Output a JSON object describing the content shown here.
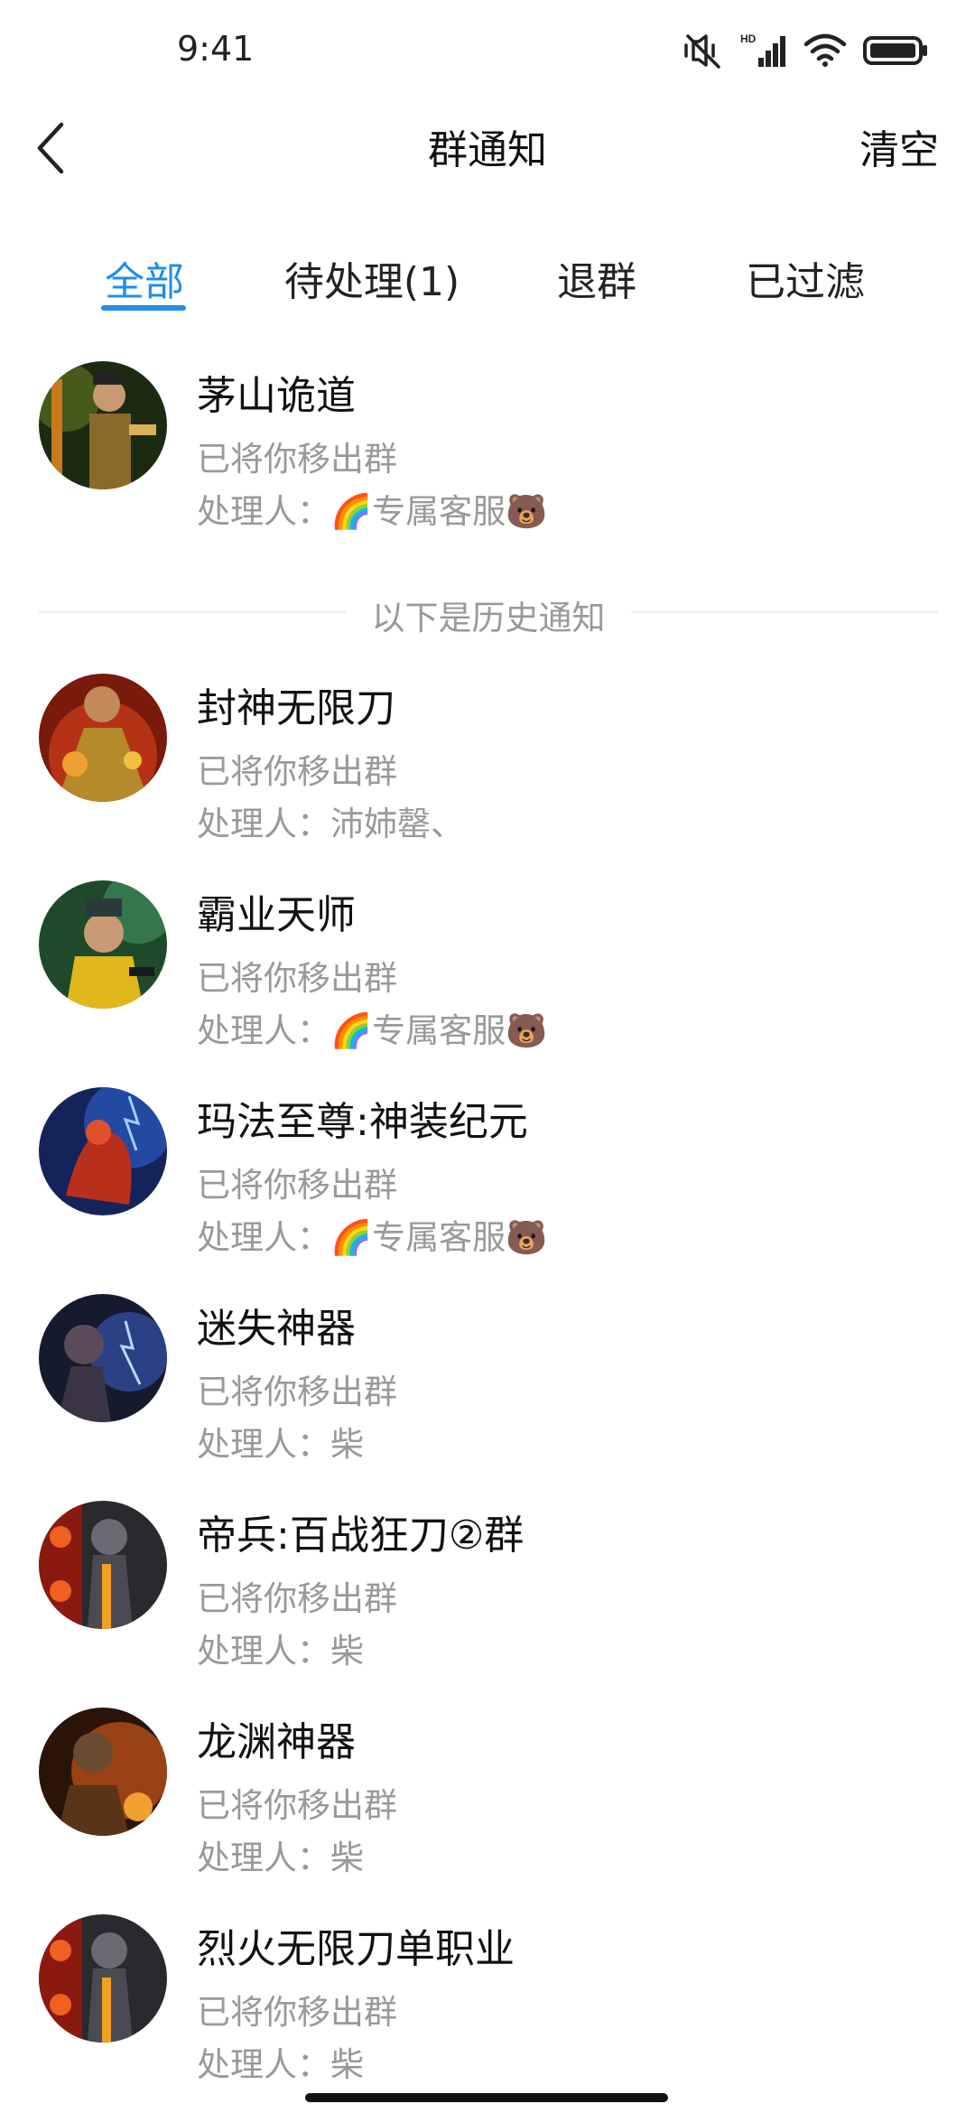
{
  "status_bar": {
    "time": "9:41",
    "icons": [
      "mute-vibrate-icon",
      "hd-signal-icon",
      "wifi-icon",
      "battery-icon"
    ]
  },
  "header": {
    "back_icon": "chevron-left-icon",
    "title": "群通知",
    "clear_label": "清空"
  },
  "tabs": [
    {
      "label": "全部",
      "active": true
    },
    {
      "label": "待处理(1)",
      "active": false
    },
    {
      "label": "退群",
      "active": false
    },
    {
      "label": "已过滤",
      "active": false
    }
  ],
  "accent_color": "#1f8eea",
  "pending_notification": {
    "group_name": "茅山诡道",
    "action": "已将你移出群",
    "handler": "处理人：🌈专属客服🐻"
  },
  "history_divider_label": "以下是历史通知",
  "history_notifications": [
    {
      "group_name": "封神无限刀",
      "action": "已将你移出群",
      "handler": "处理人：沛姉罄、"
    },
    {
      "group_name": "霸业天师",
      "action": "已将你移出群",
      "handler": "处理人：🌈专属客服🐻"
    },
    {
      "group_name": "玛法至尊:神装纪元",
      "action": "已将你移出群",
      "handler": "处理人：🌈专属客服🐻"
    },
    {
      "group_name": "迷失神器",
      "action": "已将你移出群",
      "handler": "处理人：柴"
    },
    {
      "group_name": "帝兵:百战狂刀②群",
      "action": "已将你移出群",
      "handler": "处理人：柴"
    },
    {
      "group_name": "龙渊神器",
      "action": "已将你移出群",
      "handler": "处理人：柴"
    },
    {
      "group_name": "烈火无限刀单职业",
      "action": "已将你移出群",
      "handler": "处理人：柴"
    }
  ]
}
